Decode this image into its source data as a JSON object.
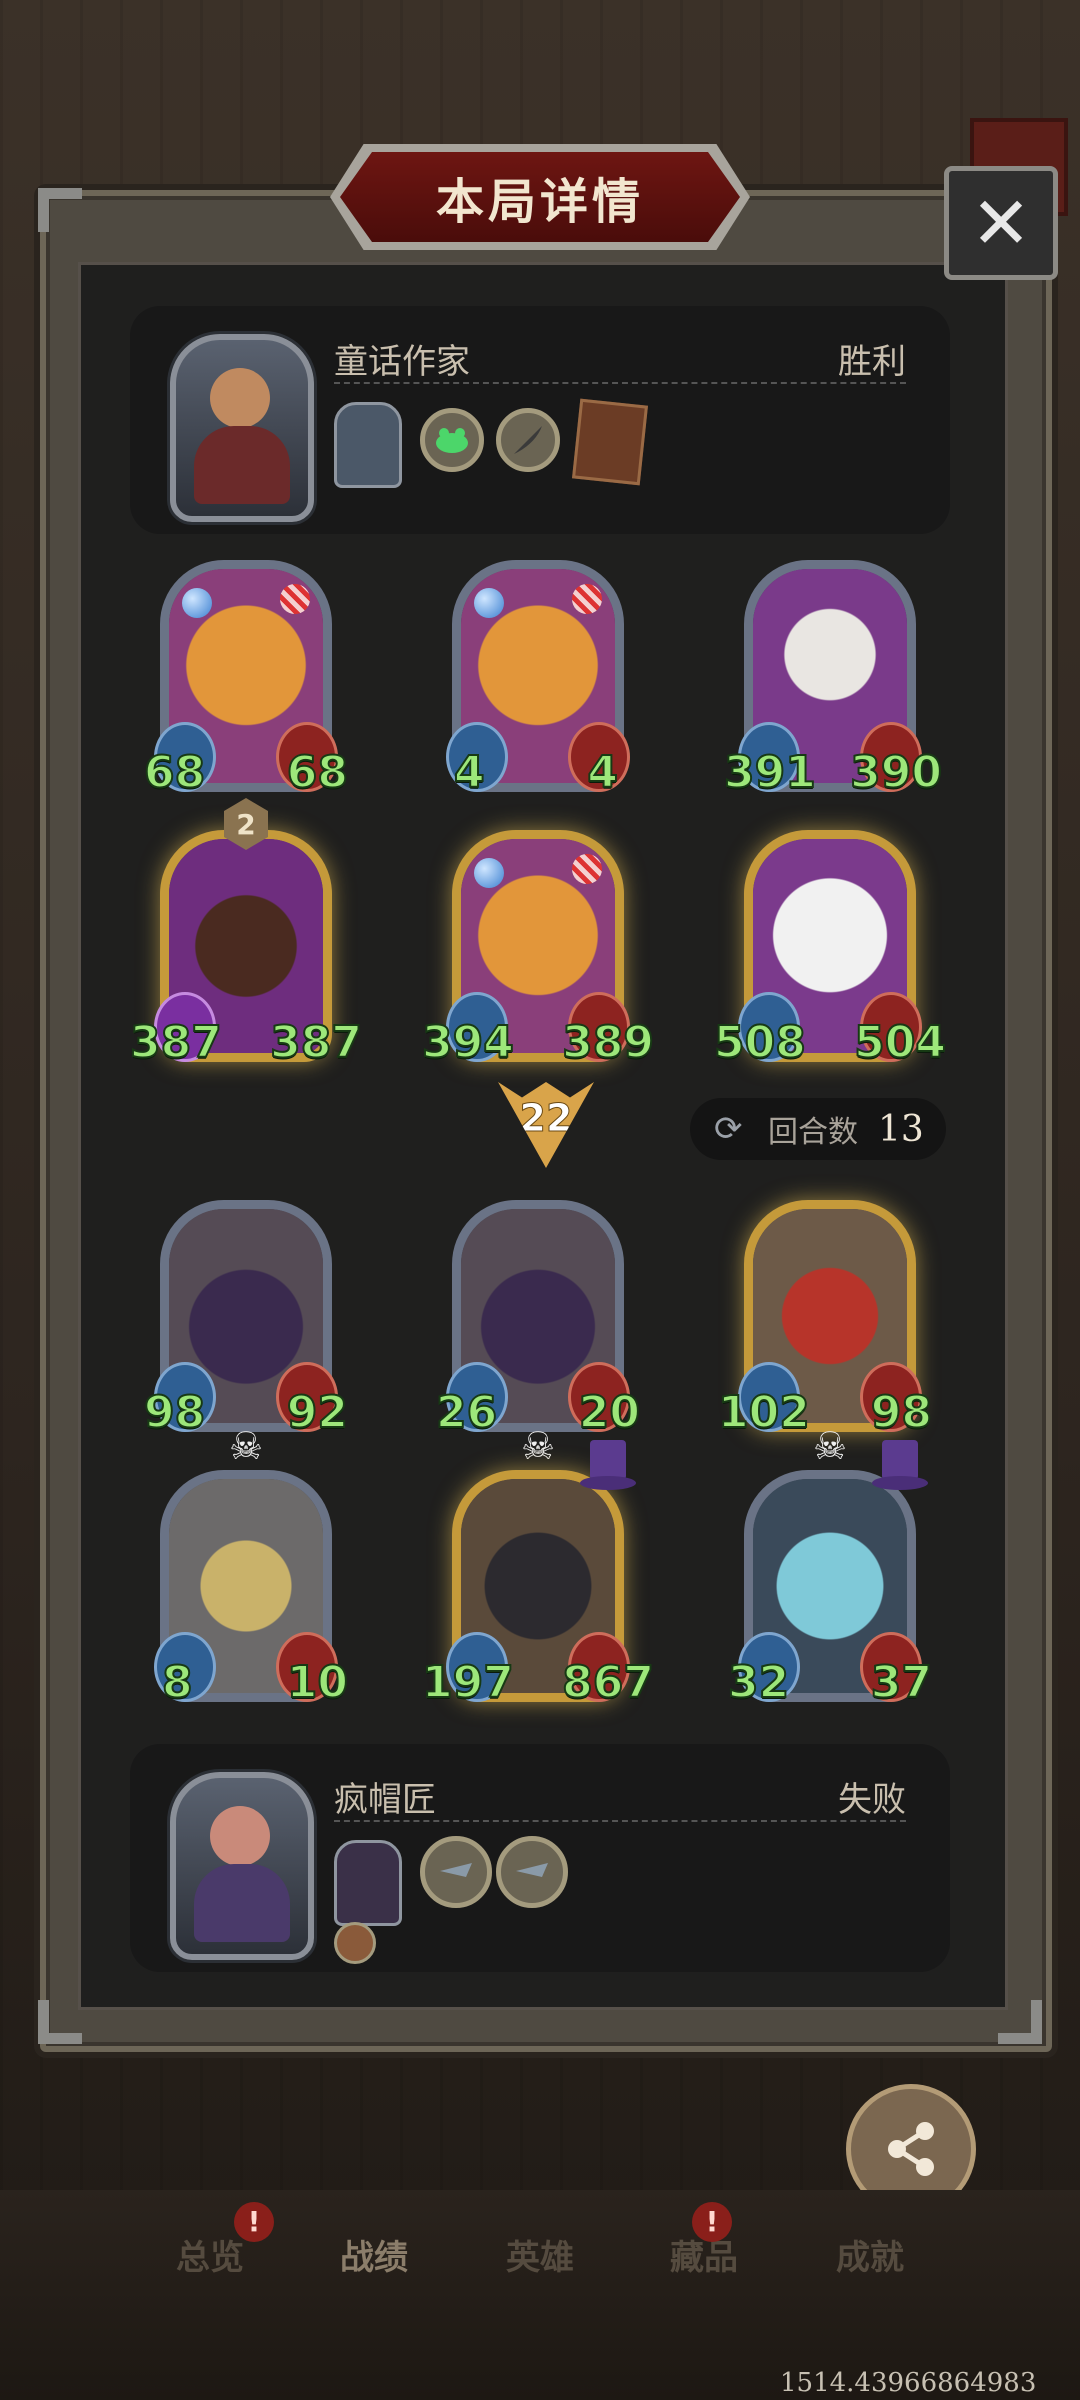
{
  "header": {
    "title": "本局详情",
    "close_icon": "✕"
  },
  "player_top": {
    "name": "童话作家",
    "result": "胜利",
    "items": [
      "frog-icon",
      "feather-icon",
      "spellbook-icon"
    ]
  },
  "player_bottom": {
    "name": "疯帽匠",
    "result": "失败"
  },
  "top_board": [
    {
      "name": "raccoon",
      "atk": "68",
      "hp": "68"
    },
    {
      "name": "raccoon",
      "atk": "4",
      "hp": "4"
    },
    {
      "name": "rabbit-mask",
      "atk": "391",
      "hp": "390"
    },
    {
      "name": "boar",
      "atk": "387",
      "hp": "387",
      "level": "2"
    },
    {
      "name": "raccoon-gold",
      "atk": "394",
      "hp": "389"
    },
    {
      "name": "goose",
      "atk": "508",
      "hp": "504"
    }
  ],
  "tier": "22",
  "round": {
    "label": "回合数",
    "value": "13"
  },
  "bottom_board": [
    {
      "name": "dark-dragon",
      "atk": "98",
      "hp": "92"
    },
    {
      "name": "dark-dragon",
      "atk": "26",
      "hp": "20"
    },
    {
      "name": "red-dragon",
      "atk": "102",
      "hp": "98"
    },
    {
      "name": "windmill",
      "atk": "8",
      "hp": "10"
    },
    {
      "name": "black-dragon",
      "atk": "197",
      "hp": "867"
    },
    {
      "name": "ice-dragon",
      "atk": "32",
      "hp": "37"
    }
  ],
  "share": {
    "label": "分享"
  },
  "nav": {
    "tabs": [
      "总览",
      "战绩",
      "英雄",
      "藏品",
      "成就"
    ],
    "badge": "!"
  },
  "coords": "1514.43966864983",
  "colors": {
    "stat_green": "#9de77a",
    "banner_red": "#6e1612",
    "gold": "#c59a3a"
  }
}
